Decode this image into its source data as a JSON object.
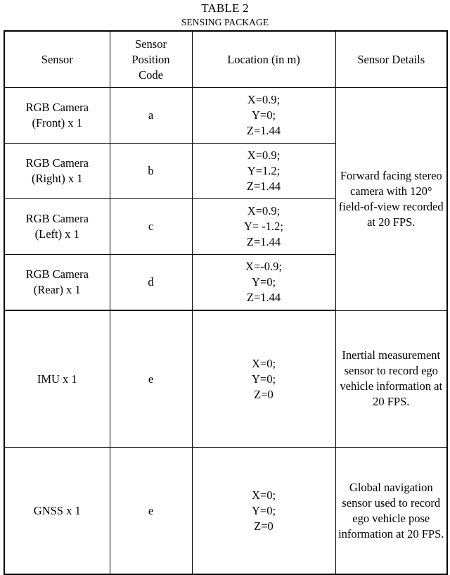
{
  "caption": {
    "number": "TABLE 2",
    "title": "SENSING PACKAGE"
  },
  "table": {
    "headers": {
      "sensor": "Sensor",
      "position_code": "Sensor\nPosition\nCode",
      "location": "Location (in m)",
      "details": "Sensor Details"
    },
    "rows": [
      {
        "sensor": "RGB Camera\n(Front) x 1",
        "code": "a",
        "location": "X=0.9;\nY=0;\nZ=1.44"
      },
      {
        "sensor": "RGB Camera\n(Right) x 1",
        "code": "b",
        "location": "X=0.9;\nY=1.2;\nZ=1.44"
      },
      {
        "sensor": "RGB Camera\n(Left) x 1",
        "code": "c",
        "location": "X=0.9;\nY= -1.2;\nZ=1.44"
      },
      {
        "sensor": "RGB Camera\n(Rear) x 1",
        "code": "d",
        "location": "X=-0.9;\nY=0;\nZ=1.44"
      },
      {
        "sensor": "IMU x 1",
        "code": "e",
        "location": "X=0;\nY=0;\nZ=0",
        "details": "Inertial measurement sensor to record ego vehicle information at 20 FPS."
      },
      {
        "sensor": "GNSS x 1",
        "code": "e",
        "location": "X=0;\nY=0;\nZ=0",
        "details": "Global navigation sensor used to record ego vehicle pose information at 20 FPS."
      }
    ],
    "camera_details": "Forward facing stereo camera with 120° field-of-view recorded at 20 FPS."
  },
  "colors": {
    "text": "#000000",
    "background": "#ffffff",
    "border": "#000000"
  }
}
